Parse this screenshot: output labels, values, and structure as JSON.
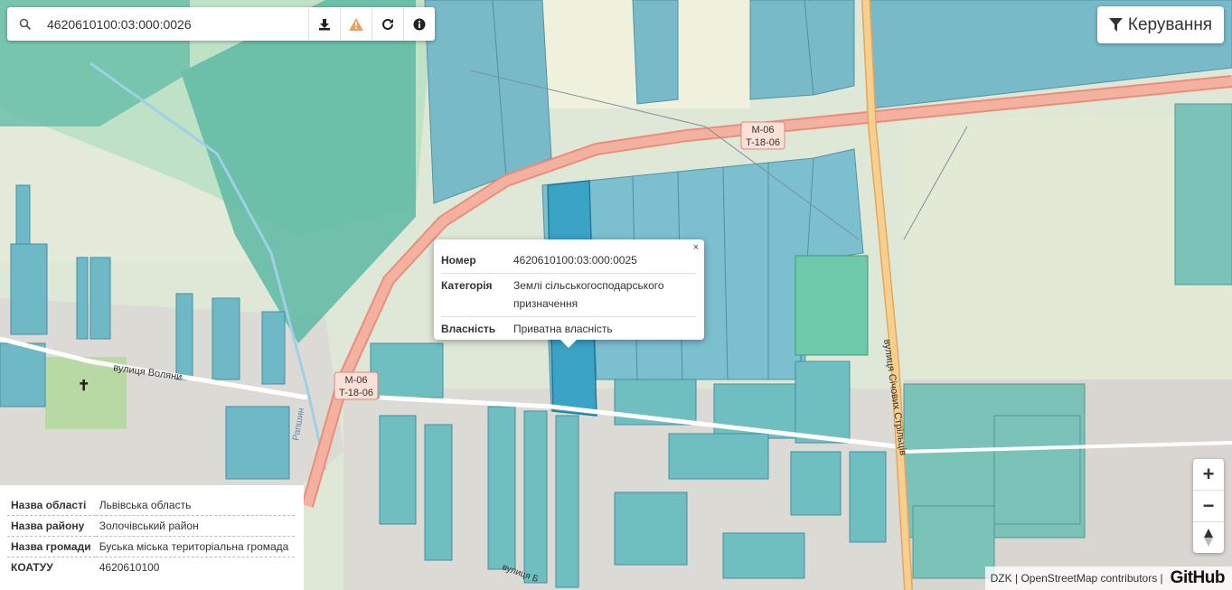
{
  "search": {
    "value": "4620610100:03:000:0026",
    "placeholder": ""
  },
  "toolbar": {
    "download_icon": "download-icon",
    "warning_icon": "warning-icon",
    "refresh_icon": "refresh-icon",
    "info_icon": "info-icon"
  },
  "control": {
    "label": "Керування",
    "icon": "filter-icon"
  },
  "popup": {
    "close": "×",
    "rows": [
      {
        "key": "Номер",
        "value": "4620610100:03:000:0025"
      },
      {
        "key": "Категорія",
        "value": "Землі сільськогосподарського призначення"
      },
      {
        "key": "Власність",
        "value": "Приватна власність"
      }
    ]
  },
  "info_panel": {
    "rows": [
      {
        "key": "Назва області",
        "value": "Львівська область"
      },
      {
        "key": "Назва району",
        "value": "Золочівський район"
      },
      {
        "key": "Назва громади",
        "value": "Буська міська територіальна громада"
      },
      {
        "key": "КОАТУУ",
        "value": "4620610100"
      }
    ]
  },
  "zoom": {
    "in": "+",
    "out": "−",
    "reset_icon": "compass-icon"
  },
  "attribution": {
    "dzk": "DZK",
    "sep": "|",
    "osm": "OpenStreetMap contributors",
    "sep2": "|",
    "github": "GitHub"
  },
  "map_labels": {
    "road_shield_1a": "M-06",
    "road_shield_1b": "T-18-06",
    "road_shield_2a": "M-06",
    "road_shield_2b": "T-18-06",
    "street_volyany": "вулиця Воляни",
    "street_sichovykh": "вулиця Січових Стрільців",
    "river": "Рапшин",
    "street_bottom": "вулиця Б"
  },
  "colors": {
    "parcel_teal": "#6ec6c0",
    "parcel_blue": "#7bb8c8",
    "parcel_dark": "#4fa9b5",
    "selected": "#3aa3c6",
    "highway": "#f0a08a",
    "road_orange": "#f6c98b",
    "green_bg": "#cfe6c1",
    "residential": "#e0ddd8"
  }
}
